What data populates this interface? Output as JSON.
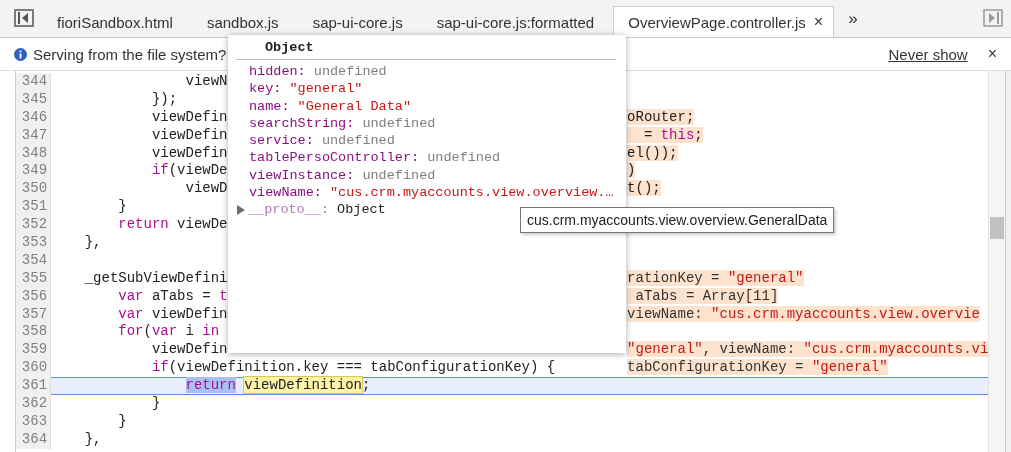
{
  "tabs": [
    {
      "label": "fioriSandbox.html",
      "selected": false
    },
    {
      "label": "sandbox.js",
      "selected": false
    },
    {
      "label": "sap-ui-core.js",
      "selected": false
    },
    {
      "label": "sap-ui-core.js:formatted",
      "selected": false
    },
    {
      "label": "OverviewPage.controller.js",
      "selected": true,
      "close": "×"
    }
  ],
  "overflow": "»",
  "infobar": {
    "message": "Serving from the file system?",
    "link": "Never show",
    "close": "×"
  },
  "code_lines": [
    {
      "number": "344",
      "current": false,
      "left": [
        {
          "kind": "plain",
          "text": "                viewN"
        }
      ]
    },
    {
      "number": "345",
      "current": false,
      "left": [
        {
          "kind": "plain",
          "text": "            });"
        }
      ]
    },
    {
      "number": "346",
      "current": false,
      "left": [
        {
          "kind": "plain",
          "text": "            viewDefin"
        }
      ],
      "right": [
        {
          "kind": "plain",
          "text": "oRouter;"
        }
      ]
    },
    {
      "number": "347",
      "current": false,
      "left": [
        {
          "kind": "plain",
          "text": "            viewDefin"
        }
      ],
      "right": [
        {
          "kind": "plain",
          "text": "  = "
        },
        {
          "kind": "kw",
          "text": "this"
        },
        {
          "kind": "plain",
          "text": ";"
        }
      ]
    },
    {
      "number": "348",
      "current": false,
      "left": [
        {
          "kind": "plain",
          "text": "            viewDefin"
        }
      ],
      "right": [
        {
          "kind": "plain",
          "text": "el());"
        }
      ]
    },
    {
      "number": "349",
      "current": false,
      "left": [
        {
          "kind": "kw",
          "text": "            if"
        },
        {
          "kind": "plain",
          "text": "(viewDe"
        }
      ],
      "right": [
        {
          "kind": "plain",
          "text": ")"
        }
      ]
    },
    {
      "number": "350",
      "current": false,
      "left": [
        {
          "kind": "plain",
          "text": "                viewD"
        }
      ],
      "right": [
        {
          "kind": "plain",
          "text": "t();"
        }
      ]
    },
    {
      "number": "351",
      "current": false,
      "left": [
        {
          "kind": "plain",
          "text": "        }"
        }
      ]
    },
    {
      "number": "352",
      "current": false,
      "left": [
        {
          "kind": "kw",
          "text": "        return"
        },
        {
          "kind": "plain",
          "text": " viewDe"
        }
      ]
    },
    {
      "number": "353",
      "current": false,
      "left": [
        {
          "kind": "plain",
          "text": "    },"
        }
      ]
    },
    {
      "number": "354",
      "current": false
    },
    {
      "number": "355",
      "current": false,
      "left": [
        {
          "kind": "plain",
          "text": "    _getSubViewDefini"
        }
      ],
      "right": [
        {
          "kind": "value",
          "text": "rationKey = "
        },
        {
          "kind": "str",
          "text": "\"general\""
        }
      ]
    },
    {
      "number": "356",
      "current": false,
      "left": [
        {
          "kind": "kw",
          "text": "        var"
        },
        {
          "kind": "plain",
          "text": " aTabs = "
        },
        {
          "kind": "kw",
          "text": "t"
        }
      ],
      "right": [
        {
          "kind": "value",
          "text": " aTabs = Array[11]"
        }
      ]
    },
    {
      "number": "357",
      "current": false,
      "left": [
        {
          "kind": "kw",
          "text": "        var"
        },
        {
          "kind": "plain",
          "text": " viewDefin"
        }
      ],
      "right": [
        {
          "kind": "value",
          "text": "viewName: "
        },
        {
          "kind": "str",
          "text": "\"cus.crm.myaccounts.view.overvie"
        }
      ]
    },
    {
      "number": "358",
      "current": false,
      "left": [
        {
          "kind": "kw",
          "text": "        for"
        },
        {
          "kind": "plain",
          "text": "("
        },
        {
          "kind": "kw",
          "text": "var"
        },
        {
          "kind": "plain",
          "text": " i "
        },
        {
          "kind": "kw",
          "text": "in"
        }
      ]
    },
    {
      "number": "359",
      "current": false,
      "left": [
        {
          "kind": "plain",
          "text": "            viewDefin"
        }
      ],
      "right": [
        {
          "kind": "str",
          "text": "\"general\""
        },
        {
          "kind": "value",
          "text": ", viewName: "
        },
        {
          "kind": "str",
          "text": "\"cus.crm.myaccounts.vi"
        }
      ]
    },
    {
      "number": "360",
      "current": false,
      "left": [
        {
          "kind": "kw",
          "text": "            if"
        },
        {
          "kind": "plain",
          "text": "(viewDefinition.key === tabConfigurationKey) {"
        }
      ],
      "right": [
        {
          "kind": "value",
          "text": "tabConfigurationKey = "
        },
        {
          "kind": "str",
          "text": "\"general\""
        }
      ]
    },
    {
      "number": "361",
      "current": true,
      "left": [
        {
          "kind": "selection",
          "text": "                return"
        },
        {
          "kind": "match",
          "text": "viewDefinition"
        },
        {
          "kind": "plain",
          "text": ";"
        }
      ]
    },
    {
      "number": "362",
      "current": false,
      "left": [
        {
          "kind": "plain",
          "text": "            }"
        }
      ]
    },
    {
      "number": "363",
      "current": false,
      "left": [
        {
          "kind": "plain",
          "text": "        }"
        }
      ]
    },
    {
      "number": "364",
      "current": false,
      "left": [
        {
          "kind": "plain",
          "text": "    },"
        }
      ]
    }
  ],
  "popup": {
    "title": "Object",
    "properties": [
      {
        "key": "hidden:",
        "value": "undefined",
        "kind": "undefined"
      },
      {
        "key": "key:",
        "value": "\"general\"",
        "kind": "string"
      },
      {
        "key": "name:",
        "value": "\"General Data\"",
        "kind": "string"
      },
      {
        "key": "searchString:",
        "value": "undefined",
        "kind": "undefined"
      },
      {
        "key": "service:",
        "value": "undefined",
        "kind": "undefined"
      },
      {
        "key": "tablePersoController:",
        "value": "undefined",
        "kind": "undefined"
      },
      {
        "key": "viewInstance:",
        "value": "undefined",
        "kind": "undefined"
      },
      {
        "key": "viewName:",
        "value": "\"cus.crm.myaccounts.view.overview.…",
        "kind": "string"
      }
    ],
    "proto": {
      "key": "__proto__:",
      "value": "Object",
      "expanded": false
    }
  },
  "tooltip": "cus.crm.myaccounts.view.overview.GeneralData"
}
